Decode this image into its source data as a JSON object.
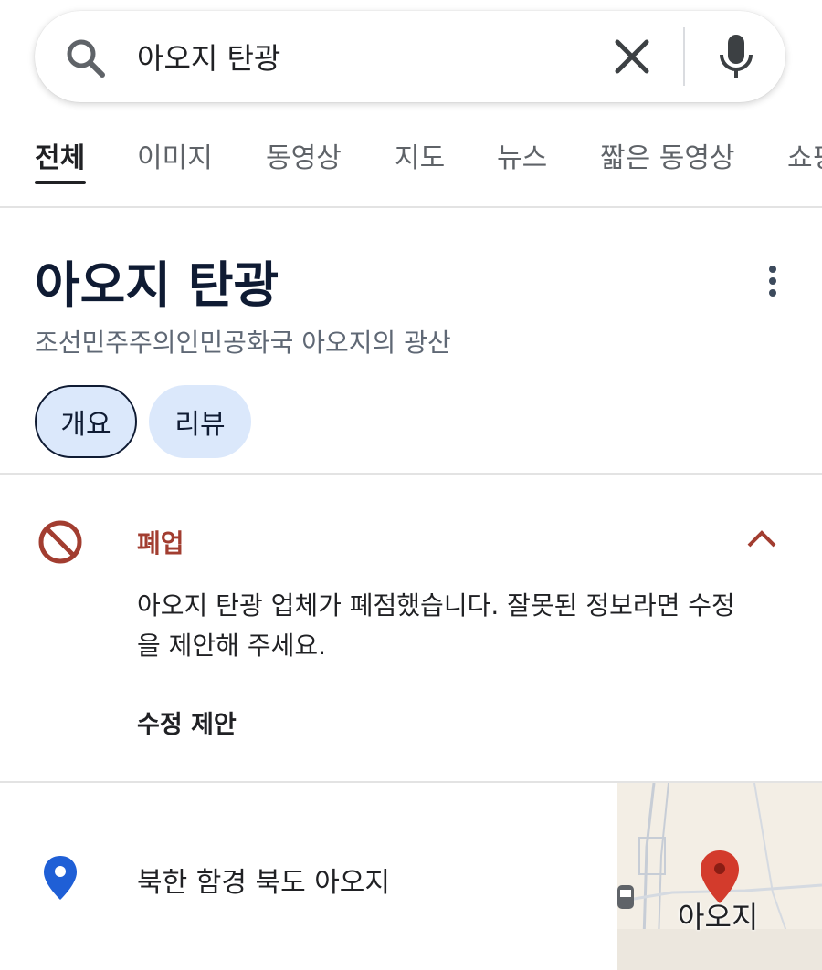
{
  "search": {
    "query": "아오지 탄광"
  },
  "tabs": [
    "전체",
    "이미지",
    "동영상",
    "지도",
    "뉴스",
    "짧은 동영상",
    "쇼핑"
  ],
  "place": {
    "title": "아오지 탄광",
    "subtitle": "조선민주주의인민공화국 아오지의 광산"
  },
  "chips": {
    "overview": "개요",
    "reviews": "리뷰"
  },
  "status": {
    "label": "폐업",
    "description": "아오지 탄광 업체가 폐점했습니다. 잘못된 정보라면 수정을 제안해 주세요.",
    "action": "수정 제안"
  },
  "location": {
    "address": "북한 함경 북도 아오지",
    "map_label": "아오지"
  },
  "colors": {
    "accent_closed": "#a23d30",
    "chip_bg": "#dbe8fb",
    "pin_blue": "#1f5fd6",
    "map_pin_red": "#d33b2c"
  },
  "icons": {
    "search": "search-icon",
    "clear": "close-icon",
    "mic": "mic-icon",
    "more": "more-vert-icon",
    "closed": "no-entry-icon",
    "collapse": "chevron-up-icon",
    "location": "location-pin-icon"
  }
}
